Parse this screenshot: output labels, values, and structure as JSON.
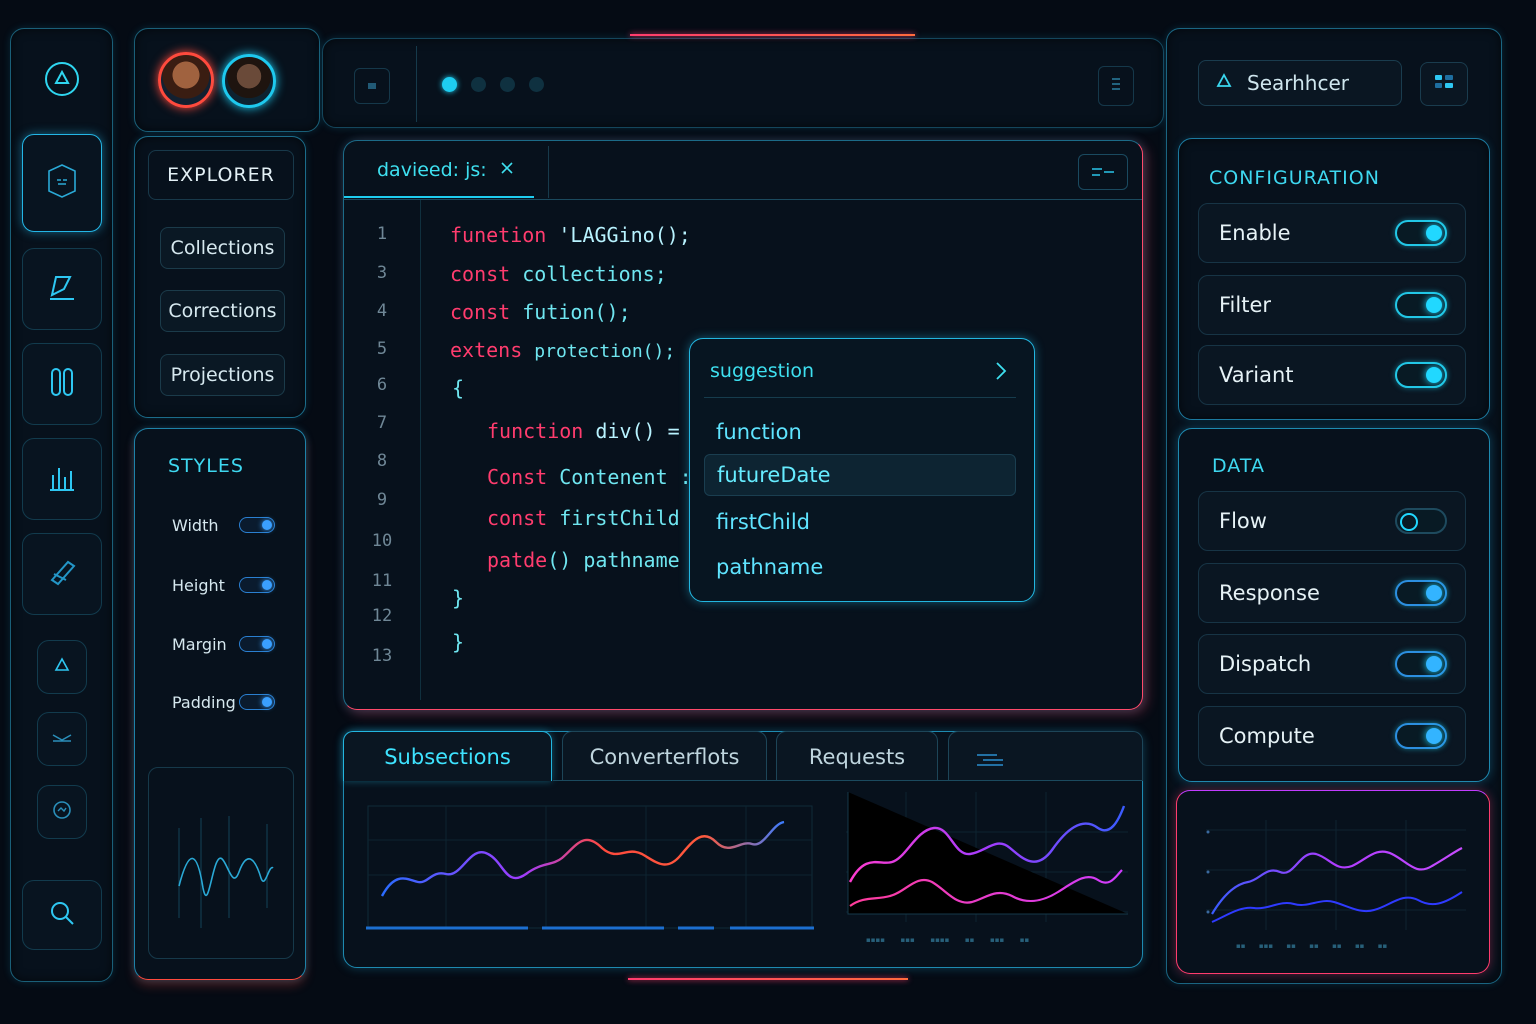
{
  "header": {
    "user_avatars": [
      "avatar-1",
      "avatar-2"
    ],
    "pager_dots": 4
  },
  "rail": {
    "icons": [
      "triangle-icon",
      "shield-icon",
      "edit-icon",
      "link-icon",
      "chart-icon",
      "pen-icon",
      "alert-icon",
      "fold-icon",
      "history-icon",
      "search-icon"
    ]
  },
  "explorer": {
    "title": "EXPLORER",
    "items": [
      "Collections",
      "Corrections",
      "Projections"
    ]
  },
  "styles": {
    "title": "STYLES",
    "rows": [
      "Width",
      "Height",
      "Margin",
      "Padding"
    ]
  },
  "editor": {
    "tab_label": "davieed: js:",
    "line_numbers": [
      "1",
      "3",
      "4",
      "5",
      "6",
      "7",
      "8",
      "9",
      "10",
      "11",
      "12",
      "13"
    ],
    "lines": [
      {
        "kw": "funetion ",
        "rest": "'LAGGino();"
      },
      {
        "kw": "const ",
        "rest": "collections;"
      },
      {
        "kw": "const ",
        "rest": "fution();"
      },
      {
        "kw": "extens ",
        "rest": "protection();"
      },
      {
        "kw": "",
        "rest": "{"
      },
      {
        "kw": "function ",
        "rest": "div() ="
      },
      {
        "kw": "Const ",
        "rest": "Contenent :"
      },
      {
        "kw": "const ",
        "rest": "firstChild"
      },
      {
        "kw": "patde",
        "rest": "() pathname"
      },
      {
        "kw": "",
        "rest": "}"
      },
      {
        "kw": "",
        "rest": "}"
      }
    ]
  },
  "suggestion": {
    "title": "suggestion",
    "items": [
      "function",
      "futureDate",
      "firstChild",
      "pathname"
    ],
    "selected": "futureDate"
  },
  "bottom_tabs": [
    "Subsections",
    "Converterflots",
    "Requests"
  ],
  "search": {
    "placeholder": "Searhhcer"
  },
  "configuration": {
    "title": "CONFIGURATION",
    "rows": [
      {
        "label": "Enable",
        "on": true
      },
      {
        "label": "Filter",
        "on": true
      },
      {
        "label": "Variant",
        "on": true
      }
    ]
  },
  "data_panel": {
    "title": "DATA",
    "rows": [
      {
        "label": "Flow",
        "on": false
      },
      {
        "label": "Response",
        "on": true
      },
      {
        "label": "Dispatch",
        "on": true
      },
      {
        "label": "Compute",
        "on": true
      }
    ]
  },
  "colors": {
    "accent": "#21d8ff",
    "keyword": "#ff3c6e",
    "background": "#050b14"
  }
}
